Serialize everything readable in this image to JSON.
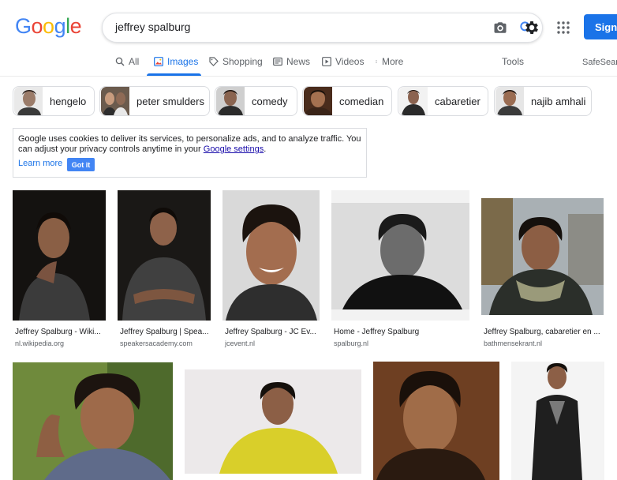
{
  "header": {
    "logo": {
      "letters": [
        "G",
        "o",
        "o",
        "g",
        "l",
        "e"
      ],
      "colors": [
        "#4285f4",
        "#ea4335",
        "#fbbc05",
        "#4285f4",
        "#34a853",
        "#ea4335"
      ]
    },
    "search": {
      "query": "jeffrey spalburg"
    },
    "signin_label": "Sign"
  },
  "tabs": [
    {
      "label": "All",
      "icon": "search-icon",
      "active": false
    },
    {
      "label": "Images",
      "icon": "image-icon",
      "active": true
    },
    {
      "label": "Shopping",
      "icon": "tag-icon",
      "active": false
    },
    {
      "label": "News",
      "icon": "news-icon",
      "active": false
    },
    {
      "label": "Videos",
      "icon": "play-icon",
      "active": false
    },
    {
      "label": "More",
      "icon": "more-vert-icon",
      "active": false
    }
  ],
  "tools_label": "Tools",
  "safesearch_label": "SafeSearch",
  "chips": [
    {
      "label": "hengelo"
    },
    {
      "label": "peter smulders"
    },
    {
      "label": "comedy"
    },
    {
      "label": "comedian"
    },
    {
      "label": "cabaretier"
    },
    {
      "label": "najib amhali"
    }
  ],
  "cookie": {
    "text": "Google uses cookies to deliver its services, to personalize ads, and to analyze traffic. You can adjust your privacy controls anytime in your ",
    "link": "Google settings",
    "text_end": ".",
    "learn_more": "Learn more",
    "got_it": "Got it"
  },
  "results_row1": [
    {
      "title": "Jeffrey Spalburg - Wiki...",
      "source": "nl.wikipedia.org"
    },
    {
      "title": "Jeffrey Spalburg | Spea...",
      "source": "speakersacademy.com"
    },
    {
      "title": "Jeffrey Spalburg - JC Ev...",
      "source": "jcevent.nl"
    },
    {
      "title": "Home - Jeffrey Spalburg",
      "source": "spalburg.nl"
    },
    {
      "title": "Jeffrey Spalburg, cabaretier en ...",
      "source": "bathmensekrant.nl"
    }
  ],
  "colors": {
    "accent": "#1a73e8",
    "link": "#1a0dab"
  }
}
